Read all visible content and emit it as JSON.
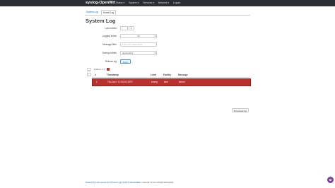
{
  "header": {
    "brand": "syslog-OpenWrt",
    "nav": [
      {
        "label": "Status ▾"
      },
      {
        "label": "System ▾"
      },
      {
        "label": "Services ▾"
      },
      {
        "label": "Network ▾"
      },
      {
        "label": "Logout"
      }
    ]
  },
  "tabs": [
    {
      "label": "System Log"
    },
    {
      "label": "Kernel Log"
    }
  ],
  "page": {
    "title": "System Log"
  },
  "filters": {
    "last_entries": {
      "label": "Last entries",
      "value": ""
    },
    "logging_levels": {
      "label": "Logging levels",
      "value": "All"
    },
    "message_filter": {
      "label": "Message filter",
      "placeholder": "Type and press Enter"
    },
    "sorting_entries": {
      "label": "Sorting entries",
      "value": "descending"
    },
    "refresh_log": {
      "label": "Refresh log"
    },
    "apply_label": "Apply"
  },
  "pager": {
    "info": "Entries: 1-1",
    "first": "«",
    "prev": "‹"
  },
  "table": {
    "columns": [
      "#",
      "Timestamp",
      "Level",
      "Facility",
      "Message"
    ],
    "rows": [
      {
        "num": "1",
        "timestamp": "Thu Jan 1 17:00:00 1970",
        "level": "emerg",
        "facility": "kern",
        "message": "kernel"
      }
    ]
  },
  "actions": {
    "download_label": "Download log"
  },
  "footer": {
    "link": "Powered by LuCI openwrt-22.03 branch (git-23.093.57104-ab2d8ac)",
    "version": "/ OpenWrt 22.03.3 r20028-43d71ad93e"
  },
  "colors": {
    "topbar": "#2b2d33",
    "error_row": "#b9312e",
    "accent": "#0069d6",
    "fab": "#7a3fa7"
  }
}
